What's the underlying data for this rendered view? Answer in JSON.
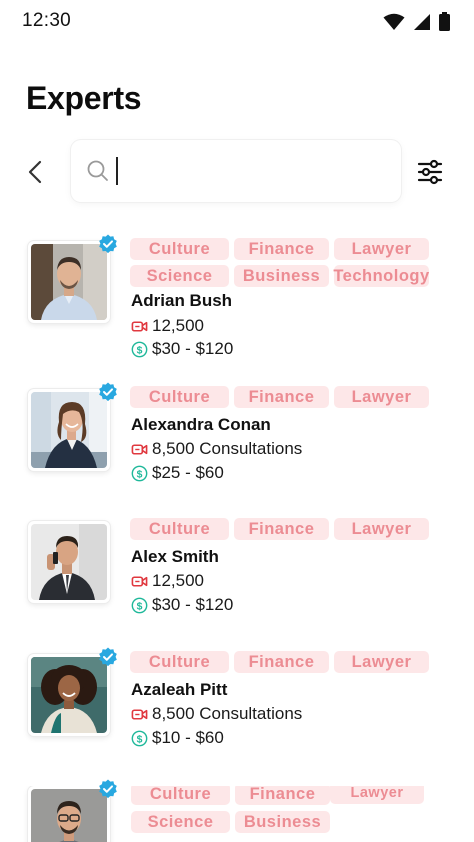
{
  "status_bar": {
    "time": "12:30"
  },
  "page_title": "Experts",
  "search": {
    "value": "",
    "placeholder": ""
  },
  "colors": {
    "tag_bg": "#fde7e8",
    "tag_text": "#ec8c93",
    "verified": "#29a8e0",
    "price_icon": "#1fb89a",
    "consult_icon": "#e0383f"
  },
  "experts": [
    {
      "name": "Adrian Bush",
      "verified": true,
      "tags": [
        "Culture",
        "Finance",
        "Lawyer",
        "Science",
        "Business",
        "Technology"
      ],
      "consultations": "12,500",
      "price": "$30 - $120"
    },
    {
      "name": "Alexandra Conan",
      "verified": true,
      "tags": [
        "Culture",
        "Finance",
        "Lawyer"
      ],
      "consultations": "8,500 Consultations",
      "price": "$25 - $60"
    },
    {
      "name": "Alex Smith",
      "verified": false,
      "tags": [
        "Culture",
        "Finance",
        "Lawyer"
      ],
      "consultations": "12,500",
      "price": "$30 - $120"
    },
    {
      "name": "Azaleah Pitt",
      "verified": true,
      "tags": [
        "Culture",
        "Finance",
        "Lawyer"
      ],
      "consultations": "8,500 Consultations",
      "price": "$10 - $60"
    },
    {
      "name": "",
      "verified": true,
      "tags": [
        "Culture",
        "Finance",
        "Lawyer",
        "Science",
        "Business"
      ],
      "consultations": "",
      "price": ""
    }
  ]
}
